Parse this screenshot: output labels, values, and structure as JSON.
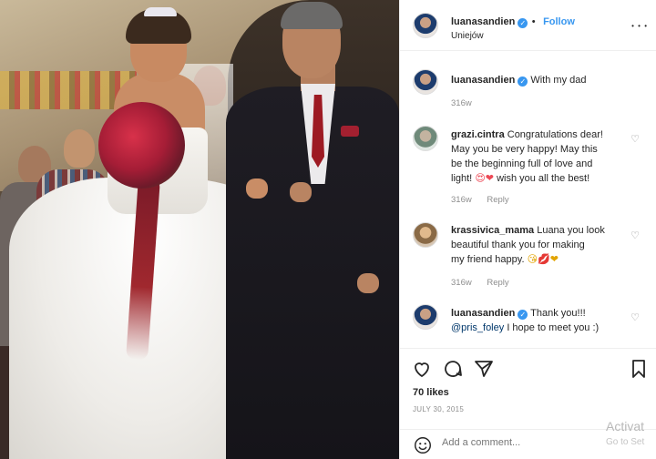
{
  "post": {
    "author": "luanasandien",
    "follow_label": "Follow",
    "location": "Uniejów",
    "more_label": "• • •",
    "caption": {
      "username": "luanasandien",
      "text": "With my dad",
      "time": "316w"
    },
    "comments": [
      {
        "username": "grazi.cintra",
        "text_line1": "Congratulations dear!",
        "text_line2": "May you be very happy! May this",
        "text_line3": "be the beginning full of love and",
        "text_line4_a": "light!",
        "text_line4_b": "wish you all the best!",
        "emoji": "😍❤",
        "time": "316w",
        "reply": "Reply"
      },
      {
        "username": "krassivica_mama",
        "text_line1": "Luana you look",
        "text_line2": "beautiful thank you for making",
        "text_line3": "my friend happy.",
        "emoji": "😘💋❤",
        "time": "316w",
        "reply": "Reply"
      },
      {
        "username": "luanasandien",
        "text_line1": "Thank you!!!",
        "mention": "@pris_foley",
        "text_line2": "I hope to meet you :)"
      }
    ],
    "likes": "70 likes",
    "date": "JULY 30, 2015",
    "comment_placeholder": "Add a comment...",
    "watermark": "Activat",
    "watermark_sub": "Go to Set"
  },
  "icons": {
    "verified": "verified-badge-icon",
    "heart": "heart-icon",
    "comment": "comment-icon",
    "share": "send-icon",
    "save": "bookmark-icon",
    "emoji": "smile-icon",
    "more": "more-icon"
  },
  "colors": {
    "link_blue": "#3897f0",
    "heart_red": "#ed4956",
    "text": "#262626",
    "muted": "#8e8e8e"
  }
}
